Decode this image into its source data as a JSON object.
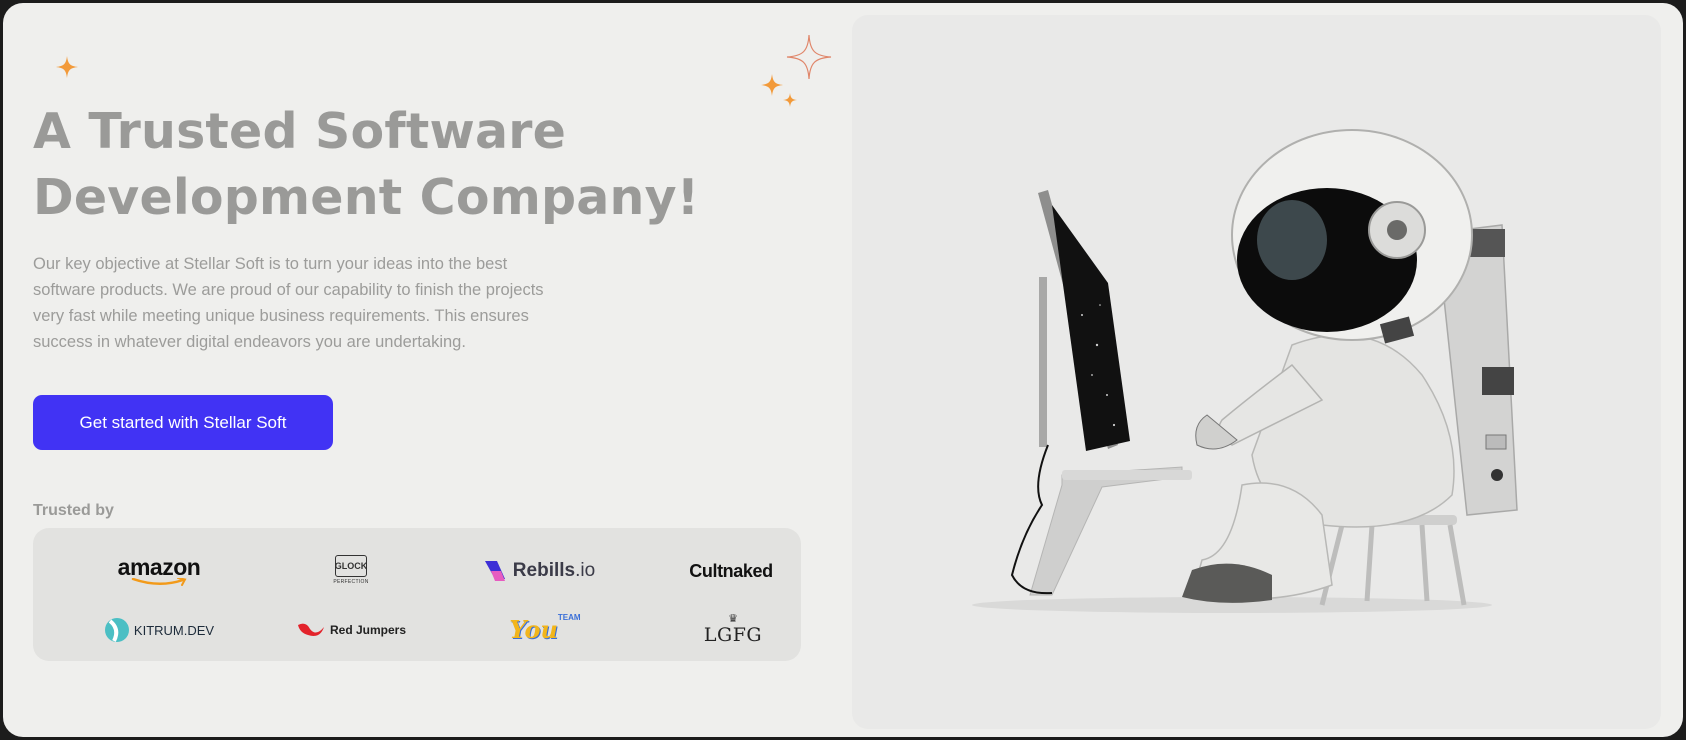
{
  "hero": {
    "title": "A Trusted Software Development Company!",
    "description": "Our key objective at Stellar Soft is to turn your ideas into the best software products. We are proud of our capability to finish the projects very fast while meeting unique business requirements. This ensures success in whatever digital endeavors you are undertaking.",
    "cta_label": "Get started with Stellar Soft"
  },
  "trusted": {
    "label": "Trusted by",
    "logos": [
      {
        "name": "amazon",
        "text": "amazon"
      },
      {
        "name": "glock",
        "text": "GLOCK",
        "sub": "PERFECTION"
      },
      {
        "name": "rebills",
        "text": "Rebills",
        "suffix": ".io"
      },
      {
        "name": "cultnaked",
        "text": "Cultnaked"
      },
      {
        "name": "kitrum",
        "text": "KITRUM.DEV"
      },
      {
        "name": "red-jumpers",
        "text": "Red Jumpers"
      },
      {
        "name": "you-team",
        "text": "You",
        "sup": "TEAM"
      },
      {
        "name": "lgfg",
        "text": "LGFG"
      }
    ]
  },
  "colors": {
    "accent": "#4133f4",
    "sparkle": "#f29a3a",
    "background": "#efefed",
    "panel": "#e9e9e8"
  },
  "icons": [
    "sparkle-icon",
    "astronaut-illustration"
  ]
}
